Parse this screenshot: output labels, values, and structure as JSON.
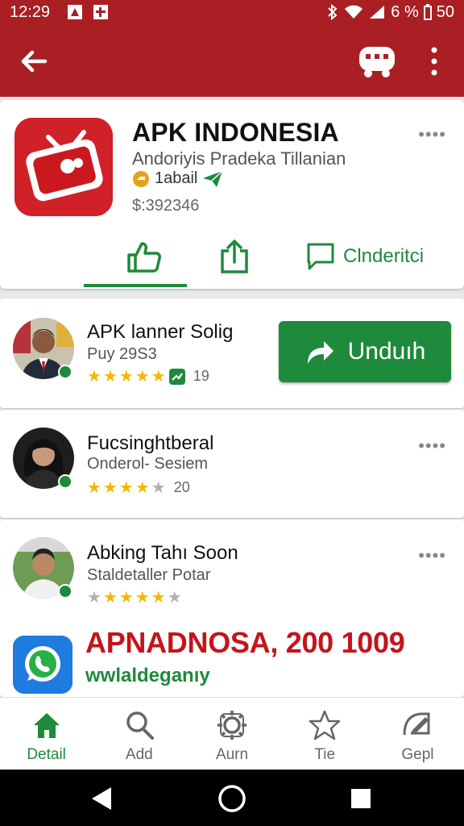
{
  "status": {
    "time": "12:29",
    "battery": "6 %",
    "signal_text": "50"
  },
  "header": {
    "title": "APK INDONESIA",
    "developer": "Andoriyis Pradeka Tillanian",
    "badge_text": "1abail",
    "price": "$:392346",
    "more": "••••",
    "actions": [
      {
        "label": ""
      },
      {
        "label": ""
      },
      {
        "label": "Clnderitci"
      }
    ]
  },
  "rows": [
    {
      "name": "APK lanner Solig",
      "sub": "Puy 29S3",
      "stars": 5,
      "count": "19"
    },
    {
      "name": "Fucsinghtberal",
      "sub": "Onderol- Sesiem",
      "stars": 4,
      "count": "20"
    },
    {
      "name": "Abking Tahı Soon",
      "sub": "Staldetaller Potar",
      "stars": 4,
      "count": ""
    }
  ],
  "download": {
    "label": "Unduıh"
  },
  "promo": {
    "title": "APNADNOSA, 200 1009",
    "subtitle": "wwlaldeganıy"
  },
  "nav": [
    {
      "label": "Detail",
      "icon": "home-icon"
    },
    {
      "label": "Add",
      "icon": "search-icon"
    },
    {
      "label": "Aurn",
      "icon": "settings-icon"
    },
    {
      "label": "Tie",
      "icon": "star-icon"
    },
    {
      "label": "Gepl",
      "icon": "edit-icon"
    }
  ],
  "colors": {
    "brand_red": "#aa1f24",
    "accent_green": "#1e8a3c",
    "star_yellow": "#f2b705"
  }
}
